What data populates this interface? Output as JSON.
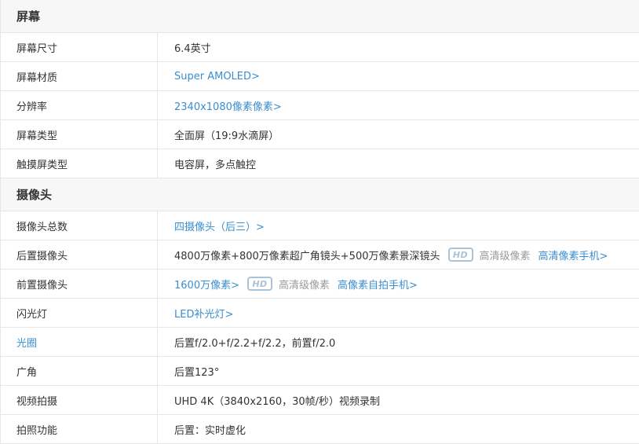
{
  "sections": [
    {
      "title": "屏幕",
      "rows": [
        {
          "label": "屏幕尺寸",
          "value": "6.4英寸"
        },
        {
          "label": "屏幕材质",
          "value": "Super AMOLED>"
        },
        {
          "label": "分辨率",
          "value": "2340x1080像素像素>"
        },
        {
          "label": "屏幕类型",
          "value": "全面屏（19:9水滴屏）"
        },
        {
          "label": "触摸屏类型",
          "value": "电容屏，多点触控"
        }
      ]
    },
    {
      "title": "摄像头",
      "rows": [
        {
          "label": "摄像头总数",
          "value": "四摄像头（后三）>"
        },
        {
          "label": "后置摄像头",
          "value": "4800万像素+800万像素超广角镜头+500万像素景深镜头",
          "badge": "HD",
          "badge_text": "高清级像素",
          "extra_link": "高清像素手机>"
        },
        {
          "label": "前置摄像头",
          "value": "1600万像素>",
          "badge": "HD",
          "badge_text": "高清级像素",
          "extra_link": "高像素自拍手机>"
        },
        {
          "label": "闪光灯",
          "value": "LED补光灯>"
        },
        {
          "label": "光圈",
          "value": "后置f/2.0+f/2.2+f/2.2，前置f/2.0"
        },
        {
          "label": "广角",
          "value": "后置123°"
        },
        {
          "label": "视频拍摄",
          "value": "UHD 4K（3840x2160，30帧/秒）视频录制"
        },
        {
          "label": "拍照功能",
          "value": "后置：实时虚化"
        }
      ]
    }
  ],
  "colors": {
    "link": "#3a8ecf",
    "text": "#333333",
    "muted": "#999999",
    "header_bg": "#f7f7f7",
    "border": "#e6e6e6"
  }
}
